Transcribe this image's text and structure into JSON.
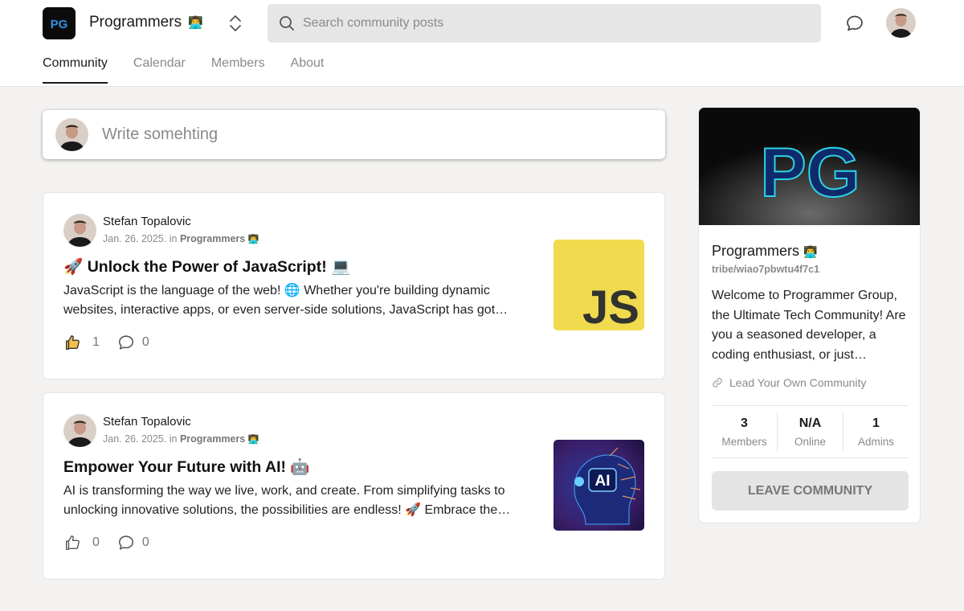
{
  "header": {
    "brand_name": "Programmers",
    "brand_emoji": "👨‍💻",
    "search_placeholder": "Search community posts",
    "logo_text": "PG"
  },
  "tabs": [
    {
      "label": "Community",
      "active": true
    },
    {
      "label": "Calendar",
      "active": false
    },
    {
      "label": "Members",
      "active": false
    },
    {
      "label": "About",
      "active": false
    }
  ],
  "composer": {
    "placeholder": "Write somehting"
  },
  "posts": [
    {
      "author": "Stefan Topalovic",
      "date": "Jan. 26. 2025.",
      "in": "in",
      "group": "Programmers",
      "group_emoji": "👨‍💻",
      "title": "🚀 Unlock the Power of JavaScript! 💻",
      "excerpt": "JavaScript is the language of the web! 🌐 Whether you're building dynamic websites, interactive apps, or even server-side solutions, JavaScript has got…",
      "likes": "1",
      "comments": "0",
      "liked": true,
      "thumb_text": "JS"
    },
    {
      "author": "Stefan Topalovic",
      "date": "Jan. 26. 2025.",
      "in": "in",
      "group": "Programmers",
      "group_emoji": "👨‍💻",
      "title": "Empower Your Future with AI! 🤖",
      "excerpt": "AI is transforming the way we live, work, and create. From simplifying tasks to unlocking innovative solutions, the possibilities are endless! 🚀 Embrace the…",
      "likes": "0",
      "comments": "0",
      "liked": false,
      "thumb_text": "AI"
    }
  ],
  "sidebar": {
    "banner_text": "PG",
    "name": "Programmers",
    "name_emoji": "👨‍💻",
    "slug": "tribe/wiao7pbwtu4f7c1",
    "description": "Welcome to Programmer Group, the Ultimate Tech Community! Are you a seasoned developer, a coding enthusiast, or just…",
    "lead_label": "Lead Your Own Community",
    "stats": [
      {
        "value": "3",
        "label": "Members"
      },
      {
        "value": "N/A",
        "label": "Online"
      },
      {
        "value": "1",
        "label": "Admins"
      }
    ],
    "leave_label": "LEAVE COMMUNITY"
  },
  "colors": {
    "js_yellow": "#f0db4f",
    "accent_blue": "#1e90ff",
    "liked_gold": "#e8b84a"
  }
}
